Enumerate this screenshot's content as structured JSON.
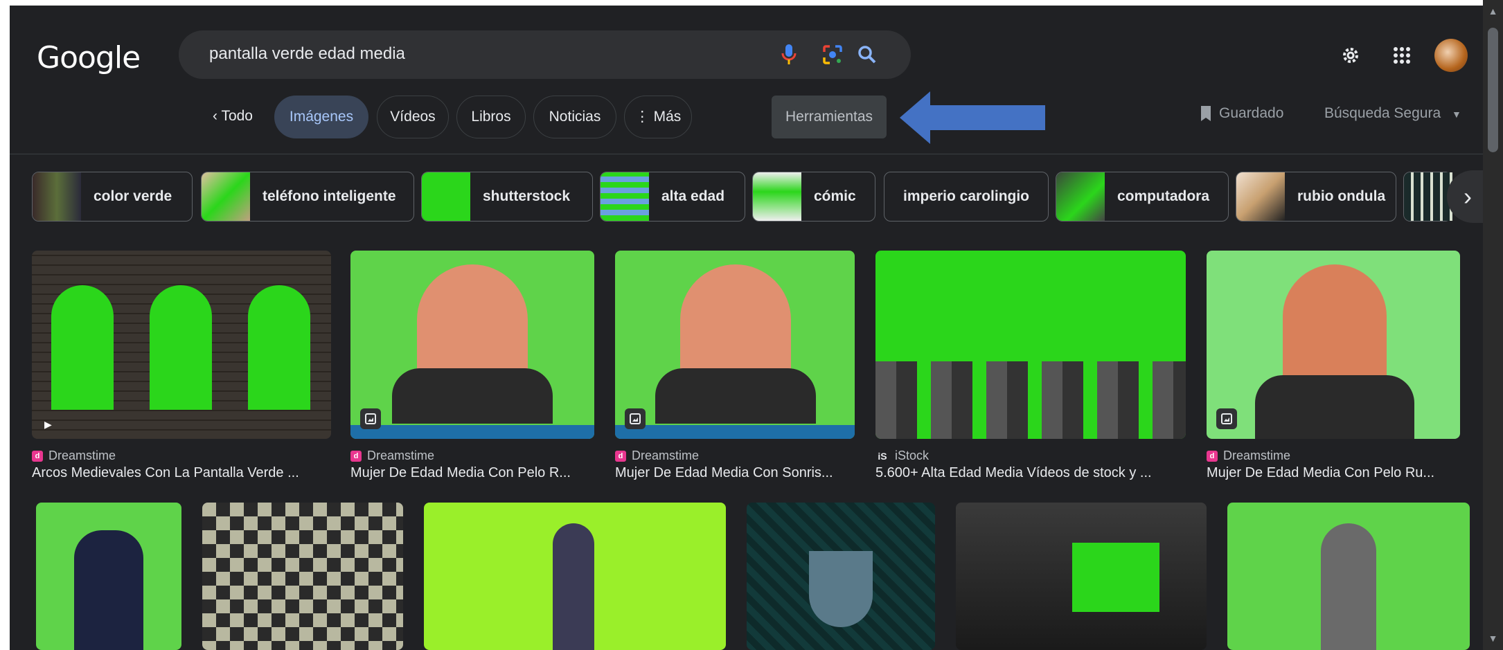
{
  "header": {
    "logo": "Google",
    "search_query": "pantalla verde edad media",
    "icons": [
      "microphone-icon",
      "lens-icon",
      "search-icon",
      "settings-gear-icon",
      "apps-grid-icon",
      "avatar"
    ]
  },
  "tabs": {
    "back": "Todo",
    "items": [
      "Imágenes",
      "Vídeos",
      "Libros",
      "Noticias",
      "Más"
    ],
    "active": "Imágenes",
    "tools": "Herramientas",
    "saved": "Guardado",
    "safe_search": "Búsqueda Segura"
  },
  "chips": [
    "color verde",
    "teléfono inteligente",
    "shutterstock",
    "alta edad",
    "cómic",
    "imperio carolingio",
    "computadora",
    "rubio ondula"
  ],
  "results_row1": [
    {
      "source": "Dreamstime",
      "title": "Arcos Medievales Con La Pantalla Verde ..."
    },
    {
      "source": "Dreamstime",
      "title": "Mujer De Edad Media Con Pelo R..."
    },
    {
      "source": "Dreamstime",
      "title": "Mujer De Edad Media Con Sonris..."
    },
    {
      "source": "iStock",
      "title": "5.600+ Alta Edad Media Vídeos de stock y ..."
    },
    {
      "source": "Dreamstime",
      "title": "Mujer De Edad Media Con Pelo Ru..."
    }
  ],
  "colors": {
    "background": "#202124",
    "search_bg": "#303134",
    "active_tab_bg": "#394457",
    "active_tab_text": "#a8c7fa",
    "annotation_arrow": "#4472c4",
    "chroma_green": "#2bd61b"
  }
}
